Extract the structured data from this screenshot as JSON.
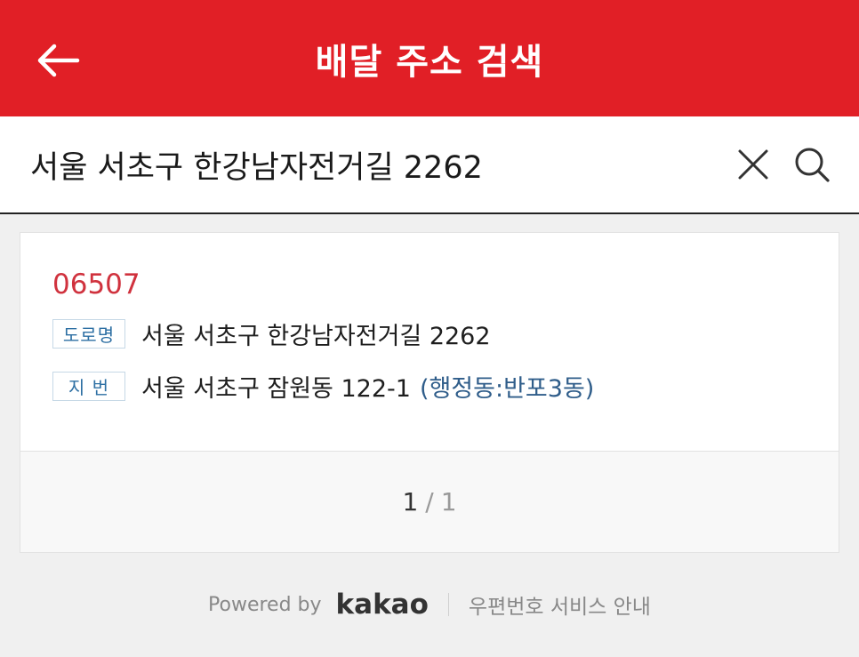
{
  "header": {
    "title": "배달 주소 검색",
    "back_icon": "arrow-left-icon"
  },
  "search": {
    "value": "서울 서초구 한강남자전거길 2262",
    "clear_icon": "close-icon",
    "search_icon": "search-icon"
  },
  "result": {
    "zipcode": "06507",
    "road_tag": "도로명",
    "road_address": "서울 서초구 한강남자전거길 2262",
    "jibun_tag": "지 번",
    "jibun_address": "서울 서초구 잠원동 122-1",
    "jibun_extra": "(행정동:반포3동)"
  },
  "pagination": {
    "current": "1",
    "separator": "/",
    "total": "1"
  },
  "footer": {
    "powered_by": "Powered by",
    "brand": "kakao",
    "service_link": "우편번호 서비스 안내"
  },
  "colors": {
    "header_bg": "#e11f26",
    "zipcode": "#d0323e",
    "tag_text": "#2d6fa3"
  }
}
